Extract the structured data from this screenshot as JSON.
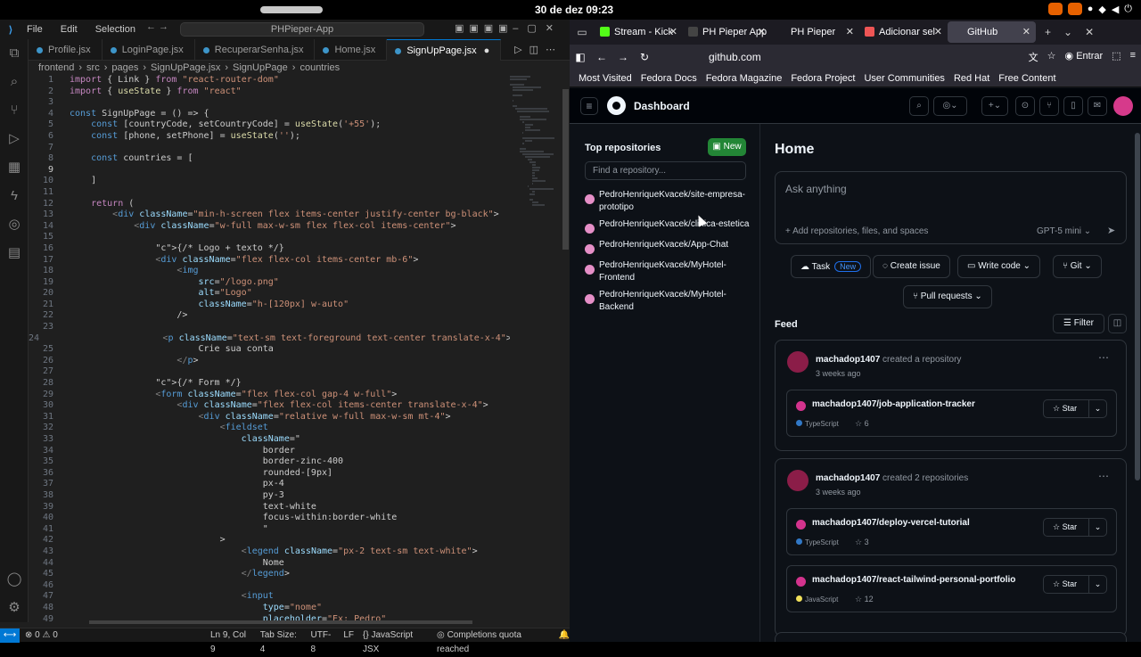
{
  "system": {
    "datetime": "30 de dez  09:23"
  },
  "vscode": {
    "title_menu": [
      "File",
      "Edit",
      "Selection"
    ],
    "window_title": "PHPieper-App",
    "tabs": [
      "Profile.jsx",
      "LoginPage.jsx",
      "RecuperarSenha.jsx",
      "Home.jsx",
      "SignUpPage.jsx"
    ],
    "active_tab": "SignUpPage.jsx",
    "breadcrumb": [
      "frontend",
      "src",
      "pages",
      "SignUpPage.jsx",
      "SignUpPage",
      "countries"
    ],
    "status": {
      "errors": "0",
      "warnings": "0",
      "position": "Ln 9, Col 9",
      "tab_size": "Tab Size: 4",
      "encoding": "UTF-8",
      "eol": "LF",
      "language": "JavaScript JSX",
      "completions": "Completions quota reached"
    },
    "code": [
      "import { Link } from \"react-router-dom\"",
      "import { useState } from \"react\"",
      "",
      "const SignUpPage = () => {",
      "    const [countryCode, setCountryCode] = useState('+55');",
      "    const [phone, setPhone] = useState('');",
      "",
      "    const countries = [",
      "",
      "    ]",
      "",
      "    return (",
      "        <div className=\"min-h-screen flex items-center justify-center bg-black\">",
      "            <div className=\"w-full max-w-sm flex flex-col items-center\">",
      "",
      "                {/* Logo + texto */}",
      "                <div className=\"flex flex-col items-center mb-6\">",
      "                    <img",
      "                        src=\"/logo.png\"",
      "                        alt=\"Logo\"",
      "                        className=\"h-[120px] w-auto\"",
      "                    />",
      "",
      "                    <p className=\"text-sm text-foreground text-center translate-x-4\">",
      "                        Crie sua conta",
      "                    </p>",
      "",
      "                {/* Form */}",
      "                <form className=\"flex flex-col gap-4 w-full\">",
      "                    <div className=\"flex flex-col items-center translate-x-4\">",
      "                        <div className=\"relative w-full max-w-sm mt-4\">",
      "                            <fieldset",
      "                                className=\"",
      "                                    border",
      "                                    border-zinc-400",
      "                                    rounded-[9px]",
      "                                    px-4",
      "                                    py-3",
      "                                    text-white",
      "                                    focus-within:border-white",
      "                                    \"",
      "                            >",
      "                                <legend className=\"px-2 text-sm text-white\">",
      "                                    Nome",
      "                                </legend>",
      "",
      "                                <input",
      "                                    type=\"nome\"",
      "                                    placeholder=\"Ex: Pedro\""
    ]
  },
  "firefox": {
    "tabs": [
      "Stream - Kick",
      "PH Pieper App",
      "PH Pieper",
      "Adicionar sel",
      "GitHub"
    ],
    "active_tab": "GitHub",
    "url": "github.com",
    "signin": "Entrar",
    "bookmarks": [
      "Most Visited",
      "Fedora Docs",
      "Fedora Magazine",
      "Fedora Project",
      "User Communities",
      "Red Hat",
      "Free Content"
    ]
  },
  "github": {
    "header_title": "Dashboard",
    "sidebar": {
      "label": "Top repositories",
      "new_button": "New",
      "find_placeholder": "Find a repository...",
      "repos": [
        "PedroHenriqueKvacek/site-empresa-prototipo",
        "PedroHenriqueKvacek/clinica-estetica",
        "PedroHenriqueKvacek/App-Chat",
        "PedroHenriqueKvacek/MyHotel-Frontend",
        "PedroHenriqueKvacek/MyHotel-Backend"
      ]
    },
    "home": "Home",
    "ask": {
      "placeholder": "Ask anything",
      "add": "Add repositories, files, and spaces",
      "model": "GPT-5 mini"
    },
    "actions": {
      "task": "Task",
      "task_badge": "New",
      "issue": "Create issue",
      "code": "Write code",
      "git": "Git",
      "prs": "Pull requests"
    },
    "feed": {
      "label": "Feed",
      "filter": "Filter"
    },
    "cards": [
      {
        "user": "machadop1407",
        "action": "created a repository",
        "ago": "3 weeks ago",
        "repos": [
          {
            "name": "machadop1407/job-application-tracker",
            "lang": "TypeScript",
            "lang_color": "#3178c6",
            "stars": "6"
          }
        ]
      },
      {
        "user": "machadop1407",
        "action": "created 2 repositories",
        "ago": "3 weeks ago",
        "repos": [
          {
            "name": "machadop1407/deploy-vercel-tutorial",
            "lang": "TypeScript",
            "lang_color": "#3178c6",
            "stars": "3"
          },
          {
            "name": "machadop1407/react-tailwind-personal-portfolio",
            "lang": "JavaScript",
            "lang_color": "#f1e05a",
            "stars": "12"
          }
        ]
      }
    ],
    "star_label": "Star"
  }
}
